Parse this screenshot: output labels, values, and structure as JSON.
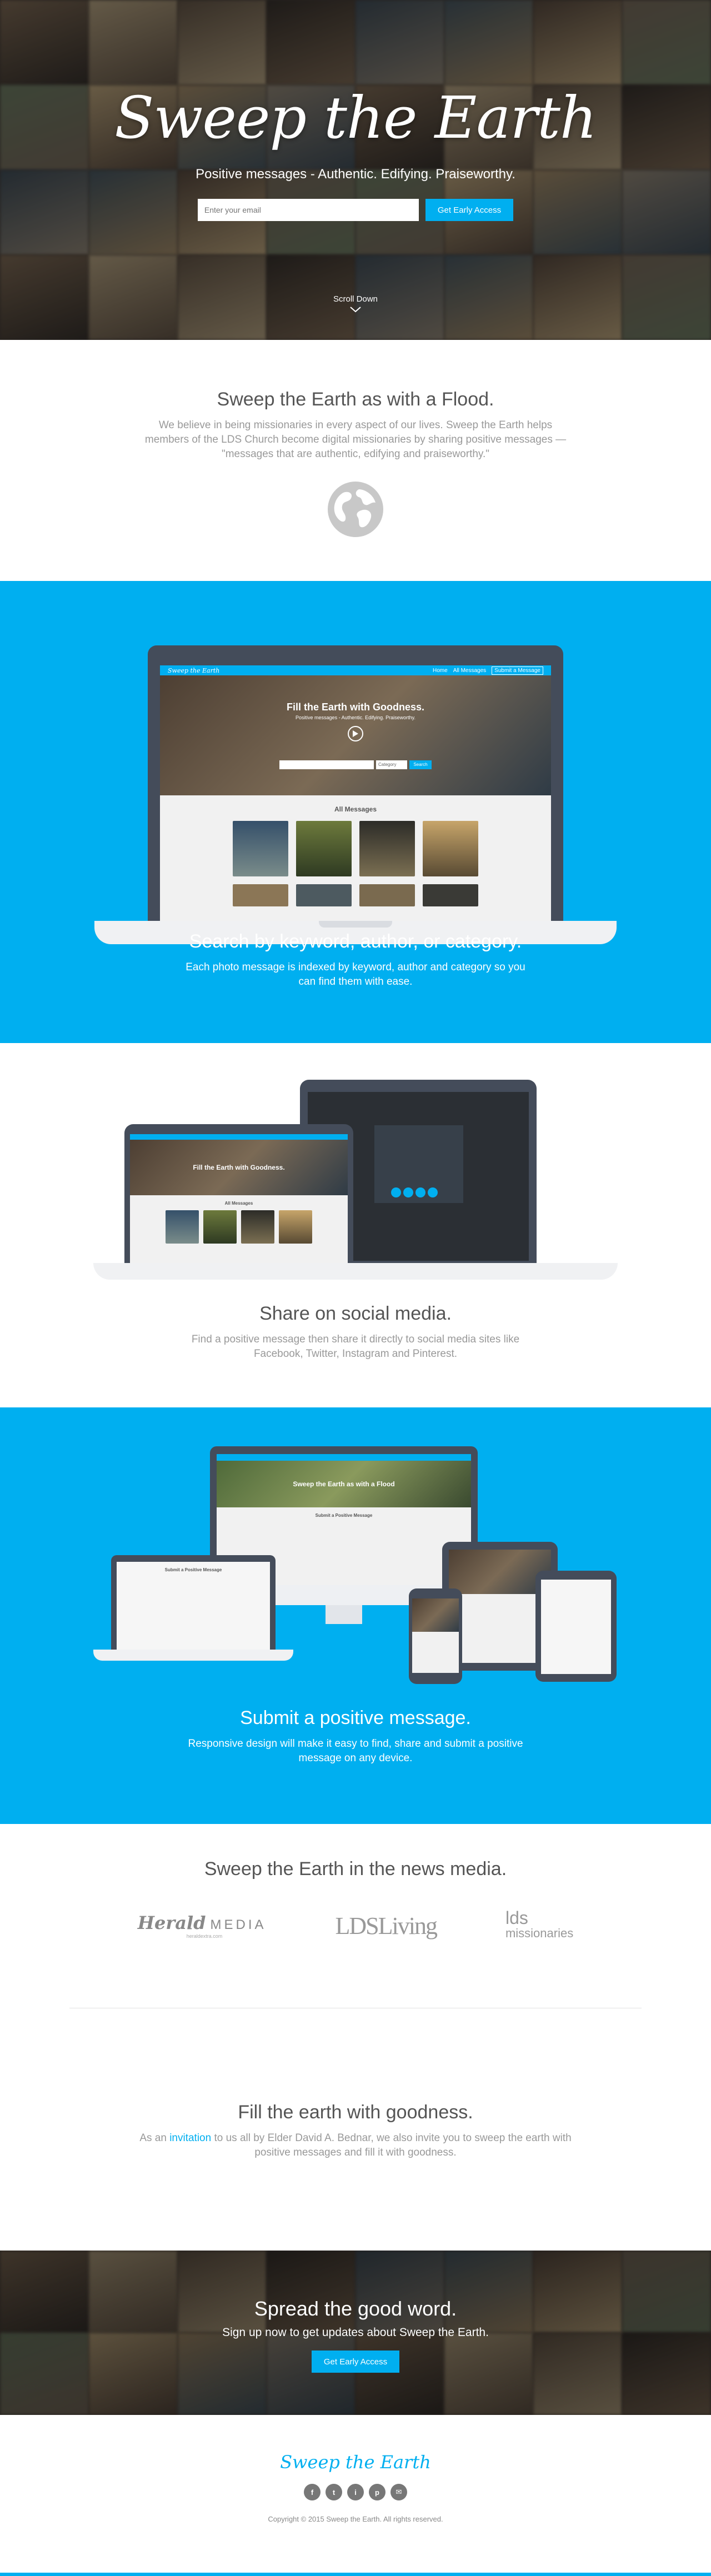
{
  "hero": {
    "title": "Sweep the Earth",
    "subtitle": "Positive messages - Authentic. Edifying. Praiseworthy.",
    "email_placeholder": "Enter your email",
    "cta_label": "Get Early Access",
    "scroll_label": "Scroll Down"
  },
  "intro": {
    "heading": "Sweep the Earth as with a Flood.",
    "body": "We believe in being missionaries in every aspect of our lives. Sweep the Earth helps members of the LDS Church become digital missionaries by sharing positive messages — \"messages that are authentic, edifying and praiseworthy.\""
  },
  "feature_search": {
    "heading": "Search by keyword, author, or category.",
    "body": "Each photo message is indexed by keyword, author and category so you can find them with ease.",
    "mock": {
      "logo": "Sweep the Earth",
      "nav": [
        "Home",
        "All Messages",
        "Submit a Message"
      ],
      "hero_title": "Fill the Earth with Goodness.",
      "hero_sub": "Positive messages - Authentic. Edifying. Praiseworthy.",
      "search_placeholder": "Search messages...",
      "category_label": "Category",
      "search_button": "Search",
      "section_title": "All Messages"
    }
  },
  "feature_share": {
    "heading": "Share on social media.",
    "body": "Find a positive message then share it directly to social media sites like Facebook, Twitter, Instagram and Pinterest."
  },
  "feature_submit": {
    "heading": "Submit a positive message.",
    "body": "Responsive design will make it easy to find, share and submit a positive message on any device.",
    "mock": {
      "hero_title": "Sweep the Earth as with a Flood",
      "form_title": "Submit a Positive Message"
    }
  },
  "news": {
    "heading": "Sweep the Earth in the news media.",
    "logos": {
      "herald": "Herald",
      "herald_media": "MEDIA",
      "herald_url": "heraldextra.com",
      "lds_living": "LDSLiving",
      "lds": "lds",
      "missionaries": "missionaries"
    }
  },
  "fill": {
    "heading": "Fill the earth with goodness.",
    "body_pre": "As an ",
    "link": "invitation",
    "body_post": " to us all by Elder David A. Bednar, we also invite you to sweep the earth with positive messages and fill it with goodness."
  },
  "spread": {
    "heading": "Spread the good word.",
    "subtitle": "Sign up now to get updates about Sweep the Earth.",
    "cta_label": "Get Early Access"
  },
  "footer": {
    "logo": "Sweep the Earth",
    "social": [
      "f",
      "t",
      "i",
      "p",
      "✉"
    ],
    "copyright": "Copyright © 2015 Sweep the Earth. All rights reserved."
  },
  "colors": {
    "accent": "#00aff0",
    "device": "#444c5a",
    "footer_logo": "#00aff0"
  }
}
